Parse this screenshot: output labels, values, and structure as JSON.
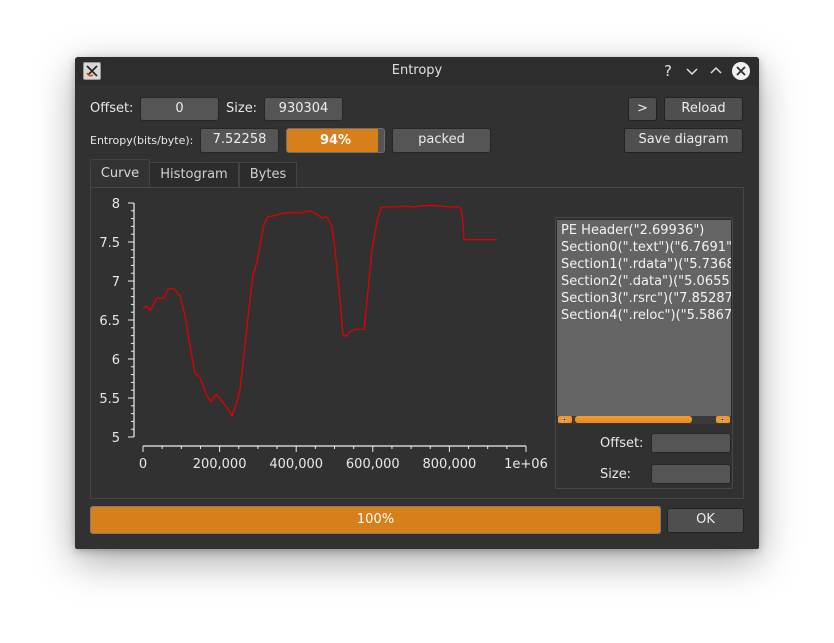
{
  "window": {
    "title": "Entropy",
    "controls": {
      "help": "?",
      "minimize": "⌄",
      "maximize": "⌃",
      "close": "✕"
    }
  },
  "toolbar": {
    "offset_label": "Offset:",
    "offset_value": "0",
    "size_label": "Size:",
    "size_value": "930304",
    "next_button": ">",
    "reload_button": "Reload",
    "entropy_label": "Entropy(bits/byte):",
    "entropy_value": "7.52258",
    "entropy_percent": 94,
    "entropy_percent_label": "94%",
    "status_value": "packed",
    "save_button": "Save diagram"
  },
  "tabs": [
    {
      "label": "Curve",
      "active": true
    },
    {
      "label": "Histogram",
      "active": false
    },
    {
      "label": "Bytes",
      "active": false
    }
  ],
  "sections": {
    "items": [
      "PE Header(\"2.69936\")",
      "Section0(\".text\")(\"6.7691\"",
      "Section1(\".rdata\")(\"5.7368",
      "Section2(\".data\")(\"5.0655",
      "Section3(\".rsrc\")(\"7.85287",
      "Section4(\".reloc\")(\"5.5867"
    ],
    "scroll_fraction": 0.75,
    "offset_label": "Offset:",
    "offset_value": "",
    "size_label": "Size:",
    "size_value": ""
  },
  "footer": {
    "progress": 100,
    "progress_label": "100%",
    "ok_button": "OK"
  },
  "colors": {
    "accent": "#d77f1a",
    "curve": "#e00000",
    "background": "#313131"
  },
  "chart_data": {
    "type": "line",
    "title": "",
    "xlabel": "",
    "ylabel": "",
    "xlim": [
      0,
      1000000
    ],
    "ylim": [
      5,
      8
    ],
    "grid": false,
    "x_ticks": [
      0,
      200000,
      400000,
      600000,
      800000,
      1000000
    ],
    "x_tick_labels": [
      "0",
      "200,000",
      "400,000",
      "600,000",
      "800,000",
      "1e+06"
    ],
    "y_ticks": [
      5,
      5.5,
      6,
      6.5,
      7,
      7.5,
      8
    ],
    "y_tick_labels": [
      "5",
      "5.5",
      "6",
      "6.5",
      "7",
      "7.5",
      "8"
    ],
    "series": [
      {
        "name": "entropy",
        "color": "#e00000",
        "x": [
          0,
          10444,
          18277,
          36554,
          54830,
          65274,
          80940,
          96606,
          109661,
          120104,
          135770,
          148825,
          164491,
          177546,
          190601,
          201044,
          208877,
          219321,
          232376,
          242820,
          253264,
          266319,
          279373,
          287206,
          297650,
          305483,
          315927,
          326371,
          336815,
          357702,
          383812,
          409922,
          436031,
          451697,
          467363,
          480418,
          493473,
          501305,
          514360,
          522193,
          530026,
          540470,
          556136,
          577023,
          587467,
          597911,
          610966,
          621410,
          634465,
          663185,
          684073,
          710183,
          723238,
          749347,
          775457,
          801567,
          822454,
          827676,
          832898,
          835509,
          838120,
          924282
        ],
        "y": [
          6.65,
          6.68,
          6.62,
          6.78,
          6.78,
          6.9,
          6.9,
          6.81,
          6.56,
          6.24,
          5.82,
          5.76,
          5.55,
          5.45,
          5.55,
          5.49,
          5.44,
          5.38,
          5.27,
          5.41,
          5.6,
          6.18,
          6.76,
          7.08,
          7.24,
          7.46,
          7.72,
          7.83,
          7.83,
          7.86,
          7.88,
          7.87,
          7.9,
          7.86,
          7.81,
          7.82,
          7.69,
          7.4,
          6.76,
          6.31,
          6.29,
          6.35,
          6.38,
          6.38,
          6.88,
          7.4,
          7.76,
          7.94,
          7.95,
          7.95,
          7.96,
          7.95,
          7.96,
          7.97,
          7.96,
          7.95,
          7.95,
          7.94,
          7.88,
          7.72,
          7.53,
          7.53
        ]
      }
    ]
  }
}
